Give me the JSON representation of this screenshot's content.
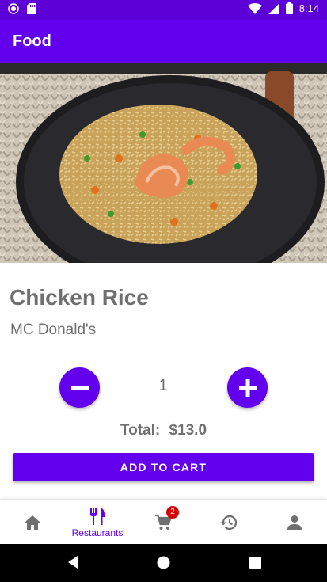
{
  "status_bar": {
    "time": "8:14"
  },
  "app_bar": {
    "title": "Food"
  },
  "food": {
    "name": "Chicken Rice",
    "restaurant": "MC Donald's",
    "quantity": "1",
    "total_label": "Total:",
    "total_value": "$13.0"
  },
  "actions": {
    "add_to_cart": "ADD TO CART"
  },
  "bottom_nav": {
    "items": [
      {
        "icon": "home-icon",
        "label": "",
        "active": false
      },
      {
        "icon": "restaurant-icon",
        "label": "Restaurants",
        "active": true
      },
      {
        "icon": "cart-icon",
        "label": "",
        "badge": "2",
        "active": false
      },
      {
        "icon": "history-icon",
        "label": "",
        "active": false
      },
      {
        "icon": "person-icon",
        "label": "",
        "active": false
      }
    ]
  },
  "colors": {
    "primary": "#6200EE",
    "status_bar": "#5C00D7",
    "text_gray": "#6f6f6f",
    "badge": "#d50000"
  }
}
